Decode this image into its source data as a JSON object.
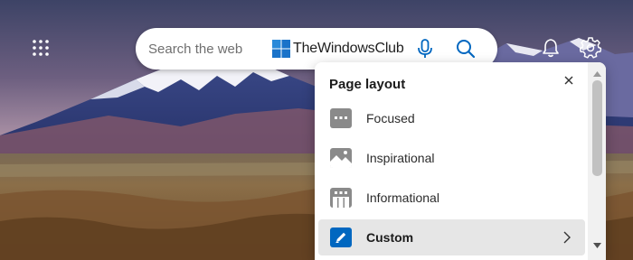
{
  "header": {
    "apps_icon": "apps-grid-icon",
    "search": {
      "placeholder": "Search the web",
      "value": "",
      "brand_text": "TheWindowsClub",
      "mic_icon": "microphone-icon",
      "search_icon": "search-icon"
    },
    "notifications_icon": "bell-icon",
    "settings_icon": "gear-icon"
  },
  "page_layout_panel": {
    "title": "Page layout",
    "close_icon": "close-icon",
    "options": [
      {
        "label": "Focused",
        "icon": "focused-layout-icon",
        "selected": false
      },
      {
        "label": "Inspirational",
        "icon": "inspirational-layout-icon",
        "selected": false
      },
      {
        "label": "Informational",
        "icon": "informational-layout-icon",
        "selected": false
      },
      {
        "label": "Custom",
        "icon": "pencil-icon",
        "selected": true,
        "has_submenu": true
      }
    ]
  },
  "colors": {
    "accent_blue": "#0067c0",
    "icon_gray": "#8a8a8a",
    "selected_row": "#e6e6e6"
  }
}
